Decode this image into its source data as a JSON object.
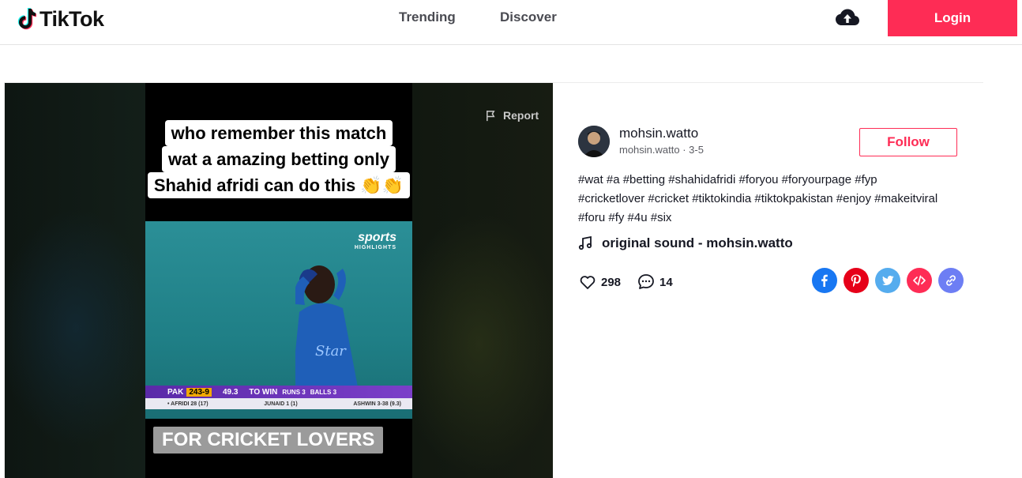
{
  "header": {
    "logo_text": "TikTok",
    "nav": [
      {
        "label": "Trending"
      },
      {
        "label": "Discover"
      }
    ],
    "login_label": "Login",
    "upload_icon": "cloud-upload-icon"
  },
  "video": {
    "caption_lines": [
      "who remember this match",
      "wat a amazing betting only",
      "Shahid afridi can do this 👏👏"
    ],
    "broadcaster": "sports",
    "broadcaster_tag": "HIGHLIGHTS",
    "score": {
      "team": "PAK",
      "score": "243-9",
      "overs": "49.3",
      "to_win": "TO WIN",
      "runs": "RUNS 3",
      "balls": "BALLS 3",
      "batter1": "• AFRIDI 28 (17)",
      "batter2": "JUNAID 1 (1)",
      "bowler": "ASHWIN 3-38 (9.3)"
    },
    "bottom_tag": "FOR CRICKET LOVERS",
    "report_label": "Report"
  },
  "info": {
    "username": "mohsin.watto",
    "subline": "mohsin.watto · 3-5",
    "follow_label": "Follow",
    "hashtags": "#wat #a #betting #shahidafridi #foryou #foryourpage #fyp #cricketlover #cricket #tiktokindia #tiktokpakistan #enjoy #makeitviral #foru #fy #4u #six",
    "music": "original sound - mohsin.watto",
    "likes": "298",
    "comments": "14",
    "share_icons": [
      "facebook-icon",
      "pinterest-icon",
      "twitter-icon",
      "embed-icon",
      "link-icon"
    ],
    "colors": {
      "brand": "#fe2c55",
      "facebook": "#1877f2",
      "pinterest": "#e60019",
      "twitter": "#55acee",
      "embed": "#fe2c55",
      "link": "#6d7ef4"
    }
  }
}
